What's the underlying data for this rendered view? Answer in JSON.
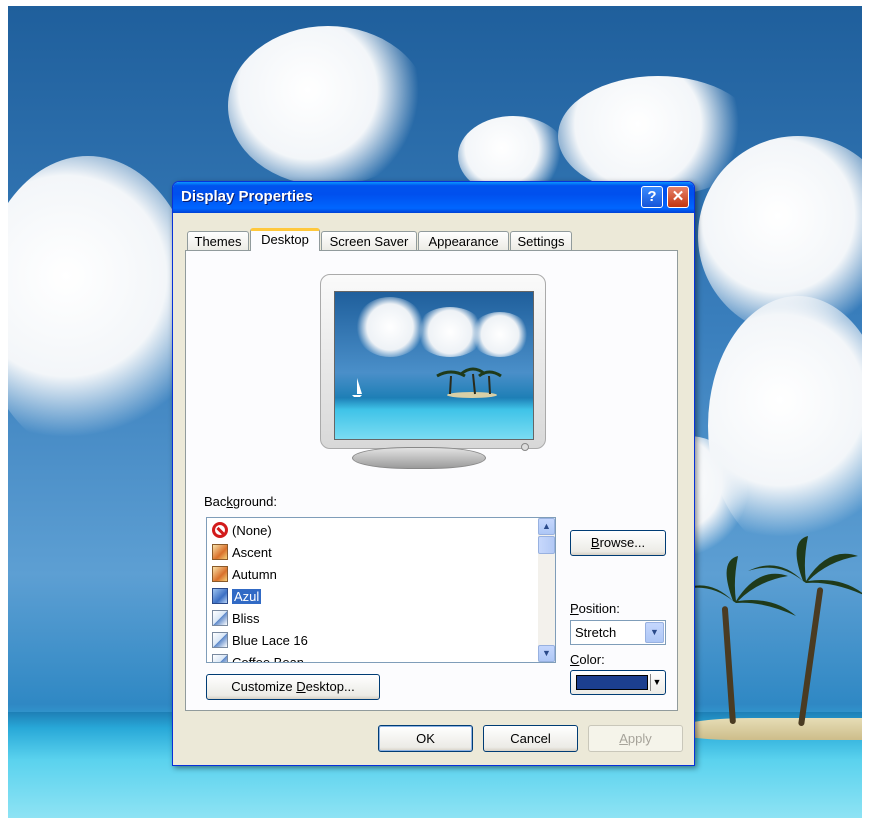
{
  "window": {
    "title": "Display Properties",
    "help_glyph": "?",
    "close_glyph": "✕"
  },
  "tabs": [
    {
      "label": "Themes"
    },
    {
      "label": "Desktop",
      "active": true
    },
    {
      "label": "Screen Saver"
    },
    {
      "label": "Appearance"
    },
    {
      "label": "Settings"
    }
  ],
  "background": {
    "label_pre": "Bac",
    "label_key": "k",
    "label_post": "ground:",
    "items": [
      {
        "label": "(None)",
        "icon": "none-icon"
      },
      {
        "label": "Ascent",
        "icon": "image-file-icon"
      },
      {
        "label": "Autumn",
        "icon": "image-file-icon"
      },
      {
        "label": "Azul",
        "icon": "image-file-icon",
        "selected": true
      },
      {
        "label": "Bliss",
        "icon": "paint-file-icon"
      },
      {
        "label": "Blue Lace 16",
        "icon": "paint-file-icon"
      },
      {
        "label": "Coffee Bean",
        "icon": "paint-file-icon"
      }
    ]
  },
  "browse_button": {
    "key": "B",
    "rest": "rowse..."
  },
  "position": {
    "label_key": "P",
    "label_rest": "osition:",
    "value": "Stretch"
  },
  "color": {
    "label_key": "C",
    "label_rest": "olor:",
    "value": "#1c3f8f"
  },
  "customize_button": {
    "pre": "Customize ",
    "key": "D",
    "post": "esktop..."
  },
  "footer": {
    "ok": "OK",
    "cancel": "Cancel",
    "apply_key": "A",
    "apply_rest": "pply"
  },
  "scroll_glyphs": {
    "up": "▲",
    "down": "▼"
  },
  "colors": {
    "accent": "#0053ee",
    "selection": "#316ac5"
  }
}
